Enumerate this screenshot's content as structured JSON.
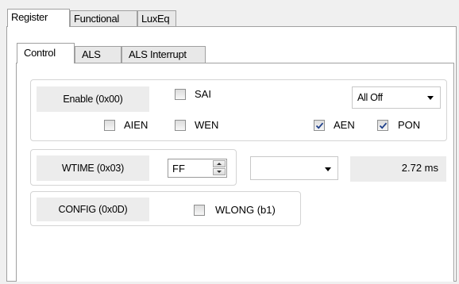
{
  "top_tabs": [
    {
      "label": "Register",
      "active": true
    },
    {
      "label": "Functional",
      "active": false
    },
    {
      "label": "LuxEq",
      "active": false
    }
  ],
  "sub_tabs": [
    {
      "label": "Control",
      "active": true
    },
    {
      "label": "ALS",
      "active": false
    },
    {
      "label": "ALS Interrupt",
      "active": false
    }
  ],
  "enable_group": {
    "label": "Enable (0x00)",
    "sai": {
      "label": "SAI",
      "checked": false
    },
    "mode_select": {
      "value": "All Off"
    },
    "aien": {
      "label": "AIEN",
      "checked": false
    },
    "wen": {
      "label": "WEN",
      "checked": false
    },
    "aen": {
      "label": "AEN",
      "checked": true
    },
    "pon": {
      "label": "PON",
      "checked": true
    }
  },
  "wtime_group": {
    "label": "WTIME (0x03)",
    "spin_value": "FF",
    "select_value": "",
    "readout": "2.72 ms"
  },
  "config_group": {
    "label": "CONFIG (0x0D)",
    "wlong": {
      "label": "WLONG (b1)",
      "checked": false
    }
  }
}
